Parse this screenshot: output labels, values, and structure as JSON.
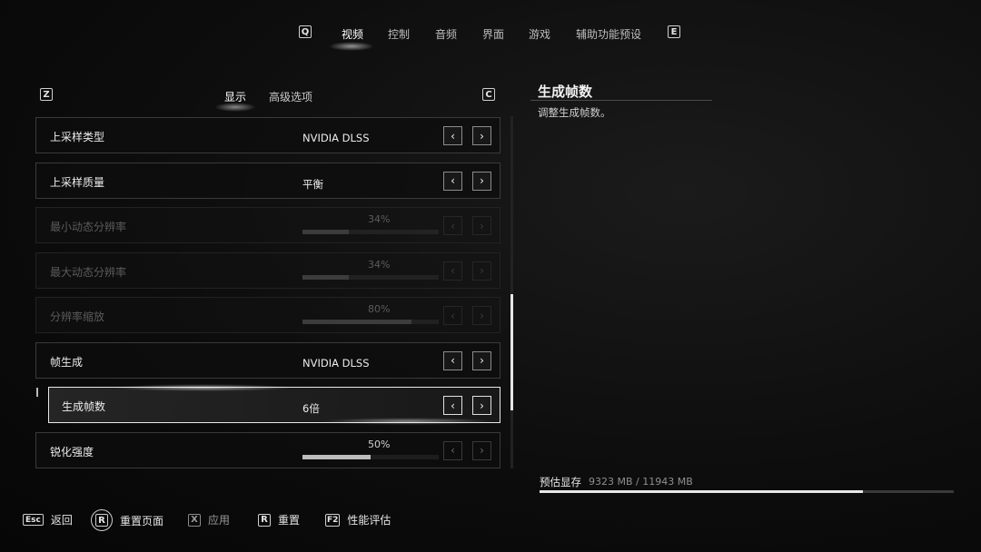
{
  "topnav": {
    "prev_key": "Q",
    "next_key": "E",
    "tabs": [
      {
        "label": "视频",
        "active": true
      },
      {
        "label": "控制"
      },
      {
        "label": "音频"
      },
      {
        "label": "界面"
      },
      {
        "label": "游戏"
      },
      {
        "label": "辅助功能预设"
      }
    ]
  },
  "subnav": {
    "prev_key": "Z",
    "next_key": "C",
    "tabs": [
      {
        "label": "显示",
        "active": true
      },
      {
        "label": "高级选项"
      }
    ]
  },
  "settings": [
    {
      "label": "上采样类型",
      "value": "NVIDIA DLSS",
      "kind": "selector"
    },
    {
      "label": "上采样质量",
      "value": "平衡",
      "kind": "selector"
    },
    {
      "label": "最小动态分辨率",
      "value": "34%",
      "progress": 0.34,
      "kind": "slider",
      "disabled": true
    },
    {
      "label": "最大动态分辨率",
      "value": "34%",
      "progress": 0.34,
      "kind": "slider",
      "disabled": true
    },
    {
      "label": "分辨率缩放",
      "value": "80%",
      "progress": 0.8,
      "kind": "slider",
      "disabled": true
    },
    {
      "label": "帧生成",
      "value": "NVIDIA DLSS",
      "kind": "selector"
    },
    {
      "label": "生成帧数",
      "value": "6倍",
      "kind": "selector",
      "selected": true
    },
    {
      "label": "锐化强度",
      "value": "50%",
      "progress": 0.5,
      "kind": "slider"
    }
  ],
  "arrows": {
    "left": "‹",
    "right": "›"
  },
  "description": {
    "title": "生成帧数",
    "body": "调整生成帧数。"
  },
  "vram": {
    "label": "预估显存",
    "value": "9323 MB / 11943 MB",
    "used_fraction": 0.7806
  },
  "hints": [
    {
      "key": "Esc",
      "label": "返回"
    },
    {
      "key": "R",
      "label": "重置页面",
      "circled": true
    },
    {
      "key": "X",
      "label": "应用",
      "disabled": true
    },
    {
      "key": "R",
      "label": "重置"
    },
    {
      "key": "F2",
      "label": "性能评估"
    }
  ],
  "colors": {
    "background": "#0d0d0d",
    "accent": "#e8e8e8",
    "disabled_text": "#5b5b5b"
  }
}
